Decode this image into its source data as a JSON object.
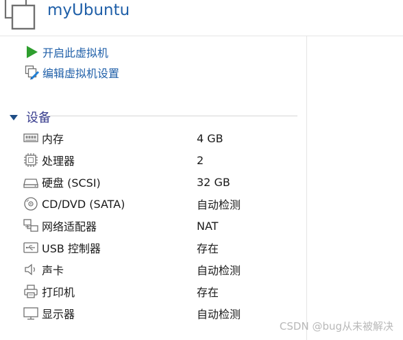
{
  "vm": {
    "name": "myUbuntu"
  },
  "actions": [
    {
      "label": "开启此虚拟机",
      "icon": "play-icon"
    },
    {
      "label": "编辑虚拟机设置",
      "icon": "edit-settings-icon"
    }
  ],
  "devices_section": {
    "title": "设备",
    "items": [
      {
        "name": "内存",
        "value": "4 GB",
        "icon": "memory-icon"
      },
      {
        "name": "处理器",
        "value": "2",
        "icon": "processor-icon"
      },
      {
        "name": "硬盘 (SCSI)",
        "value": "32 GB",
        "icon": "hard-disk-icon"
      },
      {
        "name": "CD/DVD (SATA)",
        "value": "自动检测",
        "icon": "cd-dvd-icon"
      },
      {
        "name": "网络适配器",
        "value": "NAT",
        "icon": "network-adapter-icon"
      },
      {
        "name": "USB 控制器",
        "value": "存在",
        "icon": "usb-icon"
      },
      {
        "name": "声卡",
        "value": "自动检测",
        "icon": "sound-card-icon"
      },
      {
        "name": "打印机",
        "value": "存在",
        "icon": "printer-icon"
      },
      {
        "name": "显示器",
        "value": "自动检测",
        "icon": "display-icon"
      }
    ]
  },
  "watermark": "CSDN @bug从未被解决",
  "colors": {
    "title_blue": "#1f5fa8",
    "section_purple": "#3a3f8f",
    "play_green": "#2e9e2e"
  }
}
